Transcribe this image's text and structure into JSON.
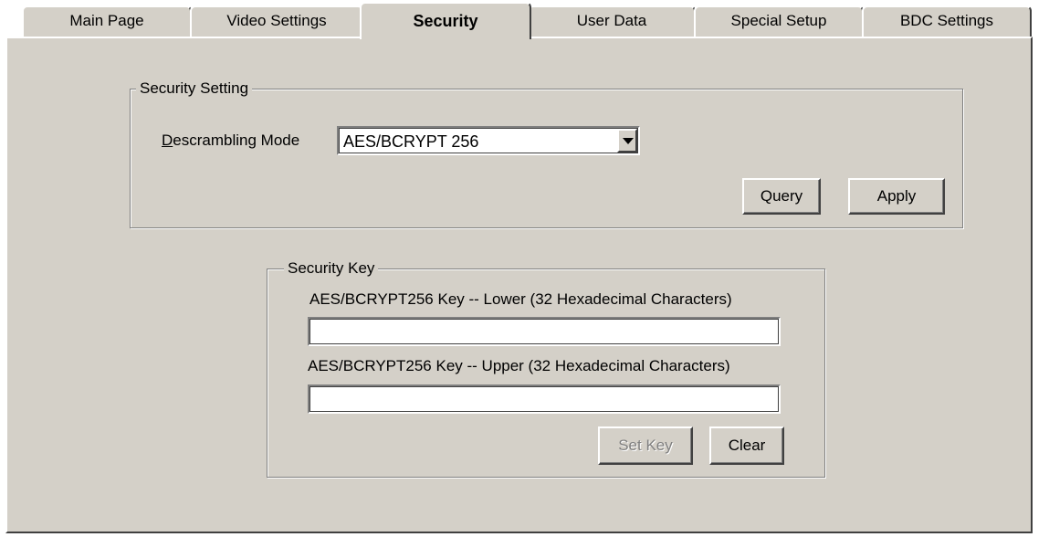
{
  "tabs": [
    {
      "label": "Main Page",
      "active": false
    },
    {
      "label": "Video Settings",
      "active": false
    },
    {
      "label": "Security",
      "active": true
    },
    {
      "label": "User Data",
      "active": false
    },
    {
      "label": "Special Setup",
      "active": false
    },
    {
      "label": "BDC Settings",
      "active": false
    }
  ],
  "security_setting": {
    "title": "Security Setting",
    "mode_label_mnemonic": "D",
    "mode_label_rest": "escrambling Mode",
    "mode_value": "AES/BCRYPT 256",
    "query_label": "Query",
    "apply_label": "Apply"
  },
  "security_key": {
    "title": "Security Key",
    "lower_label": "AES/BCRYPT256 Key -- Lower (32 Hexadecimal Characters)",
    "lower_value": "",
    "upper_label": "AES/BCRYPT256 Key -- Upper (32 Hexadecimal Characters)",
    "upper_value": "",
    "set_key_label": "Set Key",
    "set_key_enabled": false,
    "clear_label": "Clear"
  },
  "colors": {
    "face": "#d4d0c8",
    "shadow": "#808080",
    "dark_shadow": "#404040",
    "highlight": "#ffffff",
    "disabled_text": "#808080"
  }
}
